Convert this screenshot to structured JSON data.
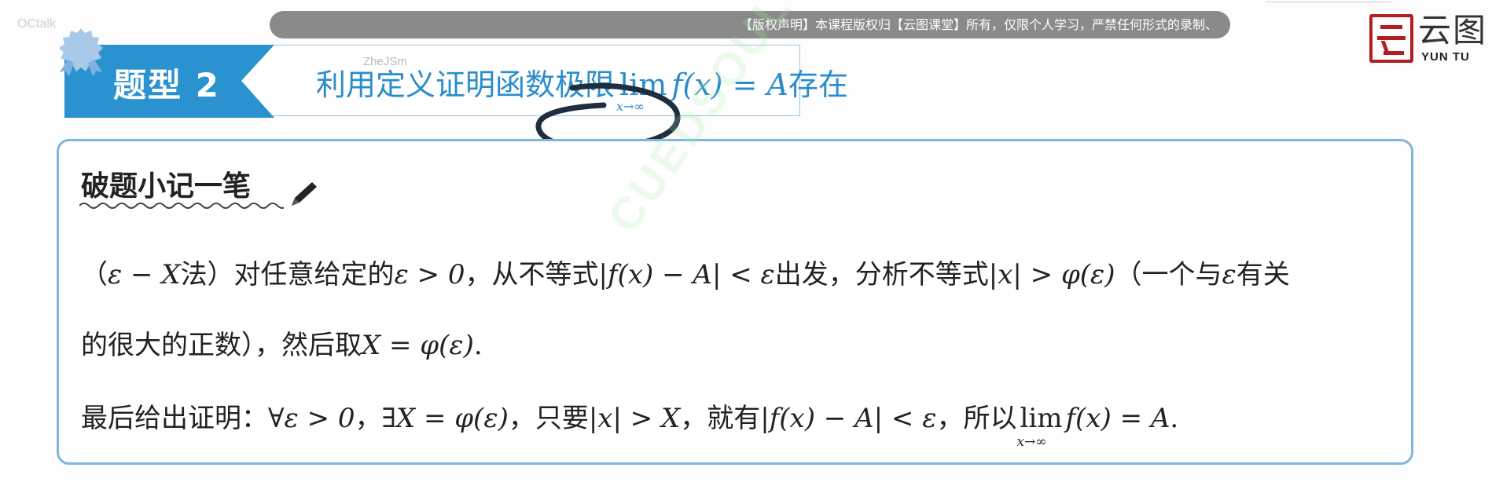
{
  "overlay": {
    "corner_text": "OCtalk"
  },
  "banner": {
    "text": "【版权声明】本课程版权归【云图课堂】所有，仅限个人学习，严禁任何形式的录制、"
  },
  "logo": {
    "cn": "云图",
    "en": "YUN TU",
    "brand_color": "#b02020"
  },
  "header": {
    "tag": "题型 2",
    "title_prefix": "利用定义证明函数极限",
    "title_lim": "lim",
    "title_lim_sub": "x→∞",
    "title_expr": "f(x) = A",
    "title_suffix": "存在",
    "accent_color": "#2a92cf"
  },
  "watermarks": {
    "top": "ZheJSm",
    "diagonal": "CUEDSOUL"
  },
  "card": {
    "heading": "破题小记一笔",
    "line1": {
      "p1": "（",
      "m1": "ε − X",
      "p2": "法）对任意给定的",
      "m2": "ε > 0",
      "p3": "，从不等式",
      "m3": "|f(x) − A| < ε",
      "p4": "出发，分析不等式",
      "m4": "|x| > φ(ε)",
      "p5": "（一个与",
      "m5": "ε",
      "p6": "有关"
    },
    "line2": {
      "p1": "的很大的正数），然后取",
      "m1": "X = φ(ε)",
      "p2": "."
    },
    "line3": {
      "p1": "最后给出证明：",
      "m1": "∀ε > 0",
      "p2": "，",
      "m2": "∃X = φ(ε)",
      "p3": "，只要",
      "m3": "|x| > X",
      "p4": "，就有",
      "m4": "|f(x) − A| < ε",
      "p5": "，所以",
      "lim": "lim",
      "lim_sub": "x→∞",
      "m5": "f(x) = A",
      "p6": "."
    }
  }
}
